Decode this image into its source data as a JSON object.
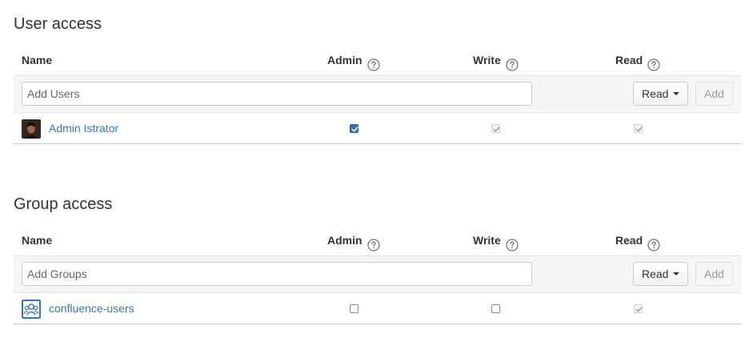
{
  "user_access": {
    "title": "User access",
    "columns": {
      "name": "Name",
      "admin": "Admin",
      "write": "Write",
      "read": "Read"
    },
    "add": {
      "placeholder": "Add Users",
      "permission_selected": "Read",
      "add_label": "Add"
    },
    "entries": [
      {
        "name": "Admin Istrator",
        "avatar_icon": "user-photo-avatar",
        "admin": "checked",
        "write": "checked-disabled",
        "read": "checked-disabled"
      }
    ]
  },
  "group_access": {
    "title": "Group access",
    "columns": {
      "name": "Name",
      "admin": "Admin",
      "write": "Write",
      "read": "Read"
    },
    "add": {
      "placeholder": "Add Groups",
      "permission_selected": "Read",
      "add_label": "Add"
    },
    "entries": [
      {
        "name": "confluence-users",
        "avatar_icon": "group-avatar-icon",
        "admin": "unchecked",
        "write": "unchecked",
        "read": "checked-disabled"
      }
    ]
  },
  "colors": {
    "link": "#3b73af",
    "checkbox_active": "#3572b0",
    "row_border": "#cccccc",
    "add_row_bg": "#f5f5f5"
  }
}
